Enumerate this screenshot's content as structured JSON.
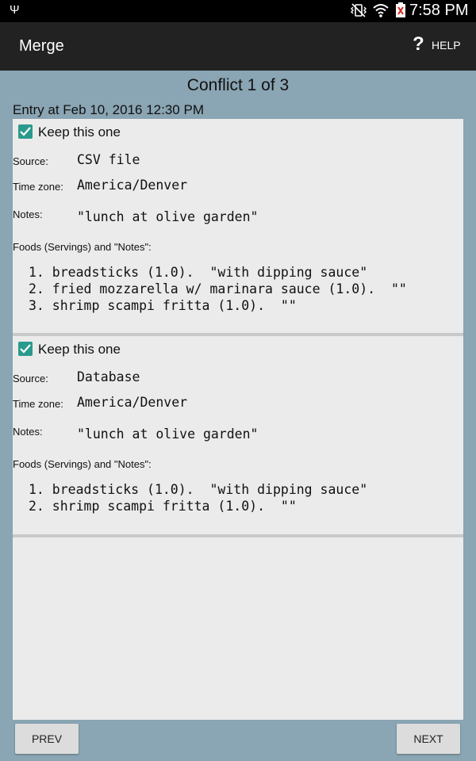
{
  "status_bar": {
    "time": "7:58 PM",
    "icons": [
      "usb-icon",
      "vibrate-icon",
      "wifi-icon",
      "battery-icon"
    ]
  },
  "action_bar": {
    "title": "Merge",
    "help_label": "HELP",
    "help_icon": "?"
  },
  "conflict": {
    "title": "Conflict 1 of 3",
    "entry_header": "Entry at Feb 10, 2016 12:30 PM"
  },
  "entries": [
    {
      "keep_label": "Keep this one",
      "keep_checked": true,
      "source_label": "Source:",
      "source_value": "CSV file",
      "timezone_label": "Time zone:",
      "timezone_value": "America/Denver",
      "notes_label": "Notes:",
      "notes_value": "\"lunch at olive garden\"",
      "foods_label": "Foods (Servings) and \"Notes\":",
      "foods": [
        "1. breadsticks (1.0).  \"with dipping sauce\"",
        "2. fried mozzarella w/ marinara sauce (1.0).  \"\"",
        "3. shrimp scampi fritta (1.0).  \"\""
      ]
    },
    {
      "keep_label": "Keep this one",
      "keep_checked": true,
      "source_label": "Source:",
      "source_value": "Database",
      "timezone_label": "Time zone:",
      "timezone_value": "America/Denver",
      "notes_label": "Notes:",
      "notes_value": "\"lunch at olive garden\"",
      "foods_label": "Foods (Servings) and \"Notes\":",
      "foods": [
        "1. breadsticks (1.0).  \"with dipping sauce\"",
        "2. shrimp scampi fritta (1.0).  \"\""
      ]
    }
  ],
  "buttons": {
    "prev": "PREV",
    "next": "NEXT"
  },
  "colors": {
    "background": "#8aa5b3",
    "action_bar": "#222222",
    "checkbox": "#2a9a8c",
    "panel": "#ebebeb"
  }
}
